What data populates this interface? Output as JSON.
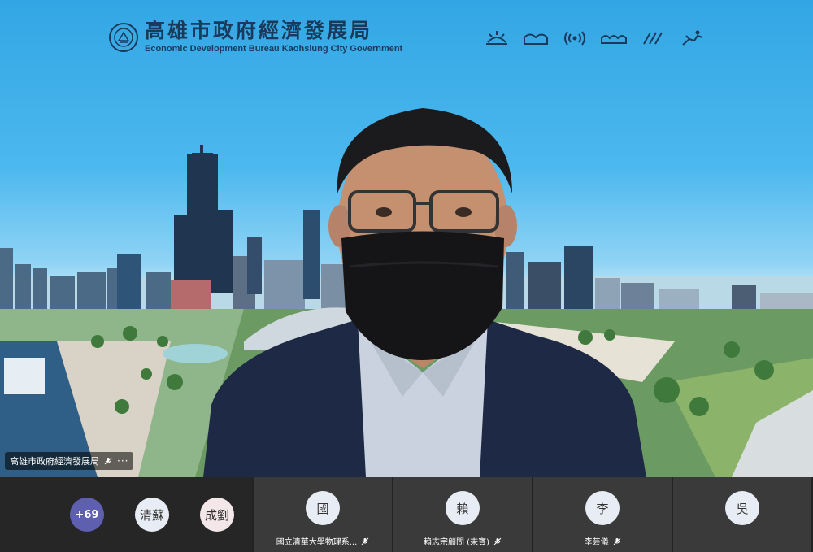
{
  "header": {
    "title": "高雄市政府經濟發展局",
    "subtitle": "Economic Development Bureau Kaohsiung City Government",
    "icons": [
      "sun-icon",
      "mountain-icon",
      "signal-icon",
      "wave-icon",
      "slash-icon",
      "runner-icon"
    ]
  },
  "main_video": {
    "name_label": "高雄市政府經濟發展局",
    "more": "···"
  },
  "participants": {
    "group_avatars": [
      {
        "label": "+69"
      },
      {
        "label": "清蘇"
      },
      {
        "label": "成劉"
      }
    ],
    "tiles": [
      {
        "avatar": "國",
        "name": "國立清華大學物理系..."
      },
      {
        "avatar": "賴",
        "name": "賴志宗顧問 (來賓)"
      },
      {
        "avatar": "李",
        "name": "李芸儀"
      },
      {
        "avatar": "吳",
        "name": ""
      }
    ]
  },
  "colors": {
    "brand": "#1a3a5c",
    "strip_bg": "#232323",
    "tile_bg": "#3a3a3a",
    "more_avatar": "#5f5fb0"
  }
}
